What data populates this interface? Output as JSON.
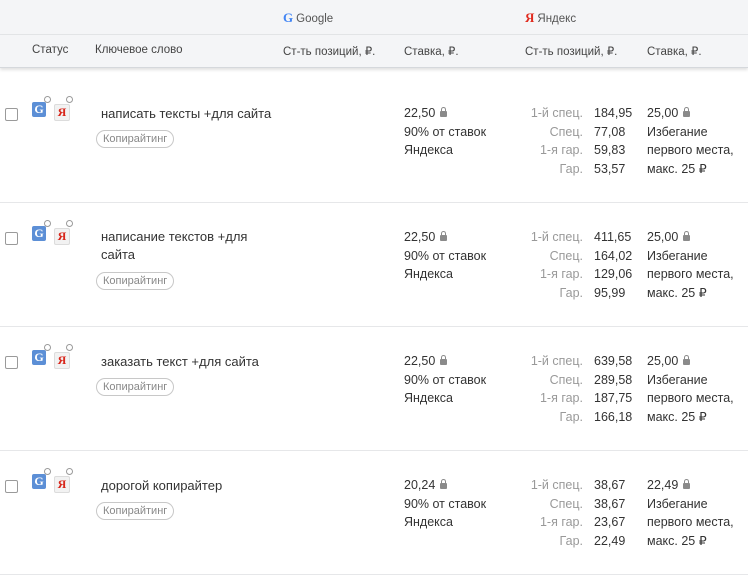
{
  "engines": {
    "google": {
      "icon": "G",
      "label": "Google"
    },
    "yandex": {
      "icon": "Я",
      "label": "Яндекс"
    }
  },
  "columns": {
    "status": "Статус",
    "keyword": "Ключевое слово",
    "google_pos_cost": "Ст-ть позиций, ₽.",
    "google_bid": "Ставка, ₽.",
    "yandex_pos_cost": "Ст-ть позиций, ₽.",
    "yandex_bid": "Ставка, ₽."
  },
  "rows": [
    {
      "keyword_lines": [
        "написать тексты +для сайта"
      ],
      "tag": "Копирайтинг",
      "google_bid": "22,50",
      "google_bid_note_1": "90% от ставок",
      "google_bid_note_2": "Яндекса",
      "positions": [
        [
          "1-й спец.",
          "184,95"
        ],
        [
          "Спец.",
          "77,08"
        ],
        [
          "1-я гар.",
          "59,83"
        ],
        [
          "Гар.",
          "53,57"
        ]
      ],
      "yandex_bid": "25,00",
      "yandex_note_1": "Избегание",
      "yandex_note_2": "первого места,",
      "yandex_note_3": "макс. 25 ₽"
    },
    {
      "keyword_lines": [
        "написание текстов +для",
        "сайта"
      ],
      "tag": "Копирайтинг",
      "google_bid": "22,50",
      "google_bid_note_1": "90% от ставок",
      "google_bid_note_2": "Яндекса",
      "positions": [
        [
          "1-й спец.",
          "411,65"
        ],
        [
          "Спец.",
          "164,02"
        ],
        [
          "1-я гар.",
          "129,06"
        ],
        [
          "Гар.",
          "95,99"
        ]
      ],
      "yandex_bid": "25,00",
      "yandex_note_1": "Избегание",
      "yandex_note_2": "первого места,",
      "yandex_note_3": "макс. 25 ₽"
    },
    {
      "keyword_lines": [
        "заказать текст +для сайта"
      ],
      "tag": "Копирайтинг",
      "google_bid": "22,50",
      "google_bid_note_1": "90% от ставок",
      "google_bid_note_2": "Яндекса",
      "positions": [
        [
          "1-й спец.",
          "639,58"
        ],
        [
          "Спец.",
          "289,58"
        ],
        [
          "1-я гар.",
          "187,75"
        ],
        [
          "Гар.",
          "166,18"
        ]
      ],
      "yandex_bid": "25,00",
      "yandex_note_1": "Избегание",
      "yandex_note_2": "первого места,",
      "yandex_note_3": "макс. 25 ₽"
    },
    {
      "keyword_lines": [
        "дорогой копирайтер"
      ],
      "tag": "Копирайтинг",
      "google_bid": "20,24",
      "google_bid_note_1": "90% от ставок",
      "google_bid_note_2": "Яндекса",
      "positions": [
        [
          "1-й спец.",
          "38,67"
        ],
        [
          "Спец.",
          "38,67"
        ],
        [
          "1-я гар.",
          "23,67"
        ],
        [
          "Гар.",
          "22,49"
        ]
      ],
      "yandex_bid": "22,49",
      "yandex_note_1": "Избегание",
      "yandex_note_2": "первого места,",
      "yandex_note_3": "макс. 25 ₽"
    }
  ]
}
